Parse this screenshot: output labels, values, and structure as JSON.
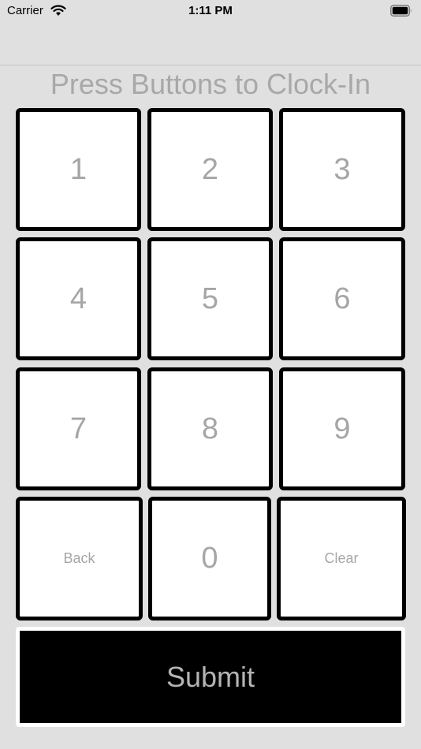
{
  "status_bar": {
    "carrier": "Carrier",
    "time": "1:11 PM",
    "wifi_icon": "wifi-icon",
    "battery_icon": "battery-icon"
  },
  "title": "Press Buttons to Clock-In",
  "keypad": {
    "key_1": "1",
    "key_2": "2",
    "key_3": "3",
    "key_4": "4",
    "key_5": "5",
    "key_6": "6",
    "key_7": "7",
    "key_8": "8",
    "key_9": "9",
    "back": "Back",
    "key_0": "0",
    "clear": "Clear"
  },
  "submit_label": "Submit",
  "colors": {
    "background": "#e0e0e0",
    "key_fill": "#ffffff",
    "key_border": "#000000",
    "key_text": "#a6a6a6",
    "submit_fill": "#000000"
  }
}
